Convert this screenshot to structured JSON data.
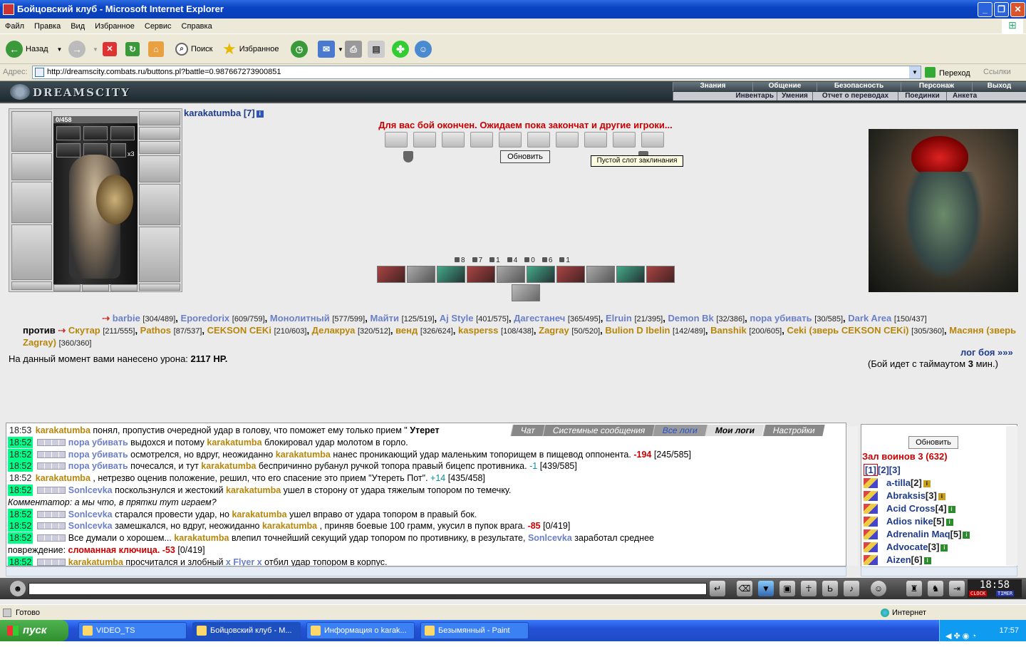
{
  "window": {
    "title": "Бойцовский клуб - Microsoft Internet Explorer"
  },
  "menu": [
    "Файл",
    "Правка",
    "Вид",
    "Избранное",
    "Сервис",
    "Справка"
  ],
  "toolbar": {
    "back": "Назад",
    "search": "Поиск",
    "favorites": "Избранное"
  },
  "address": {
    "label": "Адрес:",
    "url": "http://dreamscity.combats.ru/buttons.pl?battle=0.987667273900851",
    "go": "Переход",
    "links": "Ссылки"
  },
  "game": {
    "logo": "DREAMSCITY",
    "nav_top": [
      "Знания",
      "Общение",
      "Безопасность",
      "Персонаж",
      "Выход"
    ],
    "nav_bottom": [
      "Инвентарь",
      "Умения",
      "Отчет о переводах",
      "Поединки",
      "Анкета"
    ],
    "hero": {
      "name": "karakatumba",
      "level": "[7]",
      "hp": "0/458",
      "ammo": "x3"
    },
    "battle_message": "Для вас бой окончен. Ожидаем пока закончат и другие игроки...",
    "refresh": "Обновить",
    "tooltip": "Пустой слот заклинания",
    "stats": [
      "8",
      "7",
      "1",
      "4",
      "0",
      "6",
      "1"
    ],
    "team1": [
      {
        "name": "barbie",
        "hp": "[304/489]"
      },
      {
        "name": "Eporedorix",
        "hp": "[609/759]"
      },
      {
        "name": "Монолитный",
        "hp": "[577/599]"
      },
      {
        "name": "Майти",
        "hp": "[125/519]"
      },
      {
        "name": "Aj Style",
        "hp": "[401/575]"
      },
      {
        "name": "Дагестанеч",
        "hp": "[365/495]"
      },
      {
        "name": "Elruin",
        "hp": "[21/395]"
      },
      {
        "name": "Demon Bk",
        "hp": "[32/386]"
      },
      {
        "name": "пора убивать",
        "hp": "[30/585]"
      },
      {
        "name": "Dark Area",
        "hp": "[150/437]"
      }
    ],
    "vs": "против",
    "team2": [
      {
        "name": "Скутар",
        "hp": "[211/555]"
      },
      {
        "name": "Pathos",
        "hp": "[87/537]"
      },
      {
        "name": "CEKSON CEKi",
        "hp": "[210/603]"
      },
      {
        "name": "Делакруа",
        "hp": "[320/512]"
      },
      {
        "name": "венд",
        "hp": "[326/624]"
      },
      {
        "name": "kasperss",
        "hp": "[108/438]"
      },
      {
        "name": "Zagray",
        "hp": "[50/520]"
      },
      {
        "name": "Bulion D Ibelin",
        "hp": "[142/489]"
      },
      {
        "name": "Banshik",
        "hp": "[200/605]"
      },
      {
        "name": "Ceki (зверь CEKSON CEKi)",
        "hp": "[305/360]"
      },
      {
        "name": "Масяня (зверь Zagray)",
        "hp": "[360/360]"
      }
    ],
    "damage_label": "На данный момент вами нанесено урона:",
    "damage_value": "2117 HP.",
    "log_link": "лог боя »»»",
    "timeout_prefix": "(Бой идет с таймаутом",
    "timeout_value": "3",
    "timeout_suffix": "мин.)"
  },
  "chat": {
    "tabs": [
      "Чат",
      "Системные сообщения",
      "Все логи",
      "Мои логи",
      "Настройки"
    ],
    "lines": [
      {
        "time": "18:53",
        "hl": false,
        "sq": false,
        "parts": [
          [
            "n",
            "karakatumba"
          ],
          [
            "",
            "понял, пропустив очередной удар в голову, что поможет ему только прием \""
          ],
          [
            "b2",
            "Утерет"
          ]
        ]
      },
      {
        "time": "18:52",
        "hl": true,
        "sq": true,
        "parts": [
          [
            "b",
            "пора убивать"
          ],
          [
            "",
            "выдохся и потому"
          ],
          [
            "n",
            "karakatumba"
          ],
          [
            "",
            "блокировал удар молотом в горло."
          ]
        ]
      },
      {
        "time": "18:52",
        "hl": true,
        "sq": true,
        "parts": [
          [
            "b",
            "пора убивать"
          ],
          [
            "",
            "осмотрелся, но вдруг, неожиданно"
          ],
          [
            "n",
            "karakatumba"
          ],
          [
            "",
            "нанес проникающий удар маленьким топорищем в пищевод оппонента."
          ],
          [
            "red",
            "-194"
          ],
          [
            "",
            "[245/585]"
          ]
        ]
      },
      {
        "time": "18:52",
        "hl": true,
        "sq": true,
        "parts": [
          [
            "b",
            "пора убивать"
          ],
          [
            "",
            "почесался, и тут"
          ],
          [
            "n",
            "karakatumba"
          ],
          [
            "",
            "беспричинно рубанул ручкой топора правый бицепс противника."
          ],
          [
            "cyan",
            "-1"
          ],
          [
            "",
            "[439/585]"
          ]
        ]
      },
      {
        "time": "18:52",
        "hl": false,
        "sq": false,
        "parts": [
          [
            "n",
            "karakatumba"
          ],
          [
            "",
            ", нетрезво оценив положение, решил, что его спасение это прием \"Утереть Пот\"."
          ],
          [
            "cyan",
            "+14"
          ],
          [
            "",
            "[435/458]"
          ]
        ]
      },
      {
        "time": "18:52",
        "hl": true,
        "sq": true,
        "parts": [
          [
            "b",
            "Sonlcevka"
          ],
          [
            "",
            "поскользнулся и жестокий"
          ],
          [
            "n",
            "karakatumba"
          ],
          [
            "",
            "ушел в сторону от удара тяжелым топором по темечку."
          ]
        ]
      },
      {
        "time": "",
        "hl": false,
        "sq": false,
        "parts": [
          [
            "i",
            "Комментатор: а мы что, в прятки тут играем?"
          ]
        ]
      },
      {
        "time": "18:52",
        "hl": true,
        "sq": true,
        "parts": [
          [
            "b",
            "Sonlcevka"
          ],
          [
            "",
            "старался провести удар, но"
          ],
          [
            "n",
            "karakatumba"
          ],
          [
            "",
            "ушел вправо от удара топором в правый бок."
          ]
        ]
      },
      {
        "time": "18:52",
        "hl": true,
        "sq": true,
        "parts": [
          [
            "b",
            "Sonlcevka"
          ],
          [
            "",
            "замешкался, но вдруг, неожиданно"
          ],
          [
            "n",
            "karakatumba"
          ],
          [
            "",
            ", приняв боевые 100 грамм, укусил в пупок врага."
          ],
          [
            "red",
            "-85"
          ],
          [
            "",
            "[0/419]"
          ]
        ]
      },
      {
        "time": "18:52",
        "hl": true,
        "sq": true,
        "parts": [
          [
            "",
            "Все думали о хорошем..."
          ],
          [
            "n",
            "karakatumba"
          ],
          [
            "",
            "влепил точнейший секущий удар топором по противнику, в результате,"
          ],
          [
            "b",
            "Sonlcevka"
          ],
          [
            "",
            "заработал среднее"
          ]
        ]
      },
      {
        "time": "",
        "hl": false,
        "sq": false,
        "parts": [
          [
            "",
            "повреждение:"
          ],
          [
            "red",
            "сломанная ключица. -53"
          ],
          [
            "",
            "[0/419]"
          ]
        ]
      },
      {
        "time": "18:52",
        "hl": true,
        "sq": true,
        "parts": [
          [
            "n",
            "karakatumba"
          ],
          [
            "",
            "просчитался и злобный"
          ],
          [
            "b",
            "x Flyer x"
          ],
          [
            "",
            "отбил удар топором в корпус."
          ]
        ]
      }
    ]
  },
  "sidebar": {
    "refresh": "Обновить",
    "hall": "Зал воинов 3 (632)",
    "pages": [
      "[1]",
      "[2]",
      "[3]"
    ],
    "players": [
      {
        "name": "a-tilla",
        "lv": "[2]"
      },
      {
        "name": "Abraksis",
        "lv": "[3]"
      },
      {
        "name": "Acid Cross",
        "lv": "[4]"
      },
      {
        "name": "Adios nike",
        "lv": "[5]"
      },
      {
        "name": "Adrenalin Maq",
        "lv": "[5]"
      },
      {
        "name": "Advocate",
        "lv": "[3]"
      },
      {
        "name": "Aizen",
        "lv": "[6]"
      }
    ]
  },
  "clock": {
    "time": "18:58",
    "label1": "CLOCK",
    "label2": "TIMER"
  },
  "status": {
    "left": "Готово",
    "right": "Интернет"
  },
  "taskbar": {
    "start": "пуск",
    "tasks": [
      "VIDEO_TS",
      "Бойцовский клуб - M...",
      "Информация о karak...",
      "Безымянный - Paint"
    ],
    "time": "17:57"
  }
}
